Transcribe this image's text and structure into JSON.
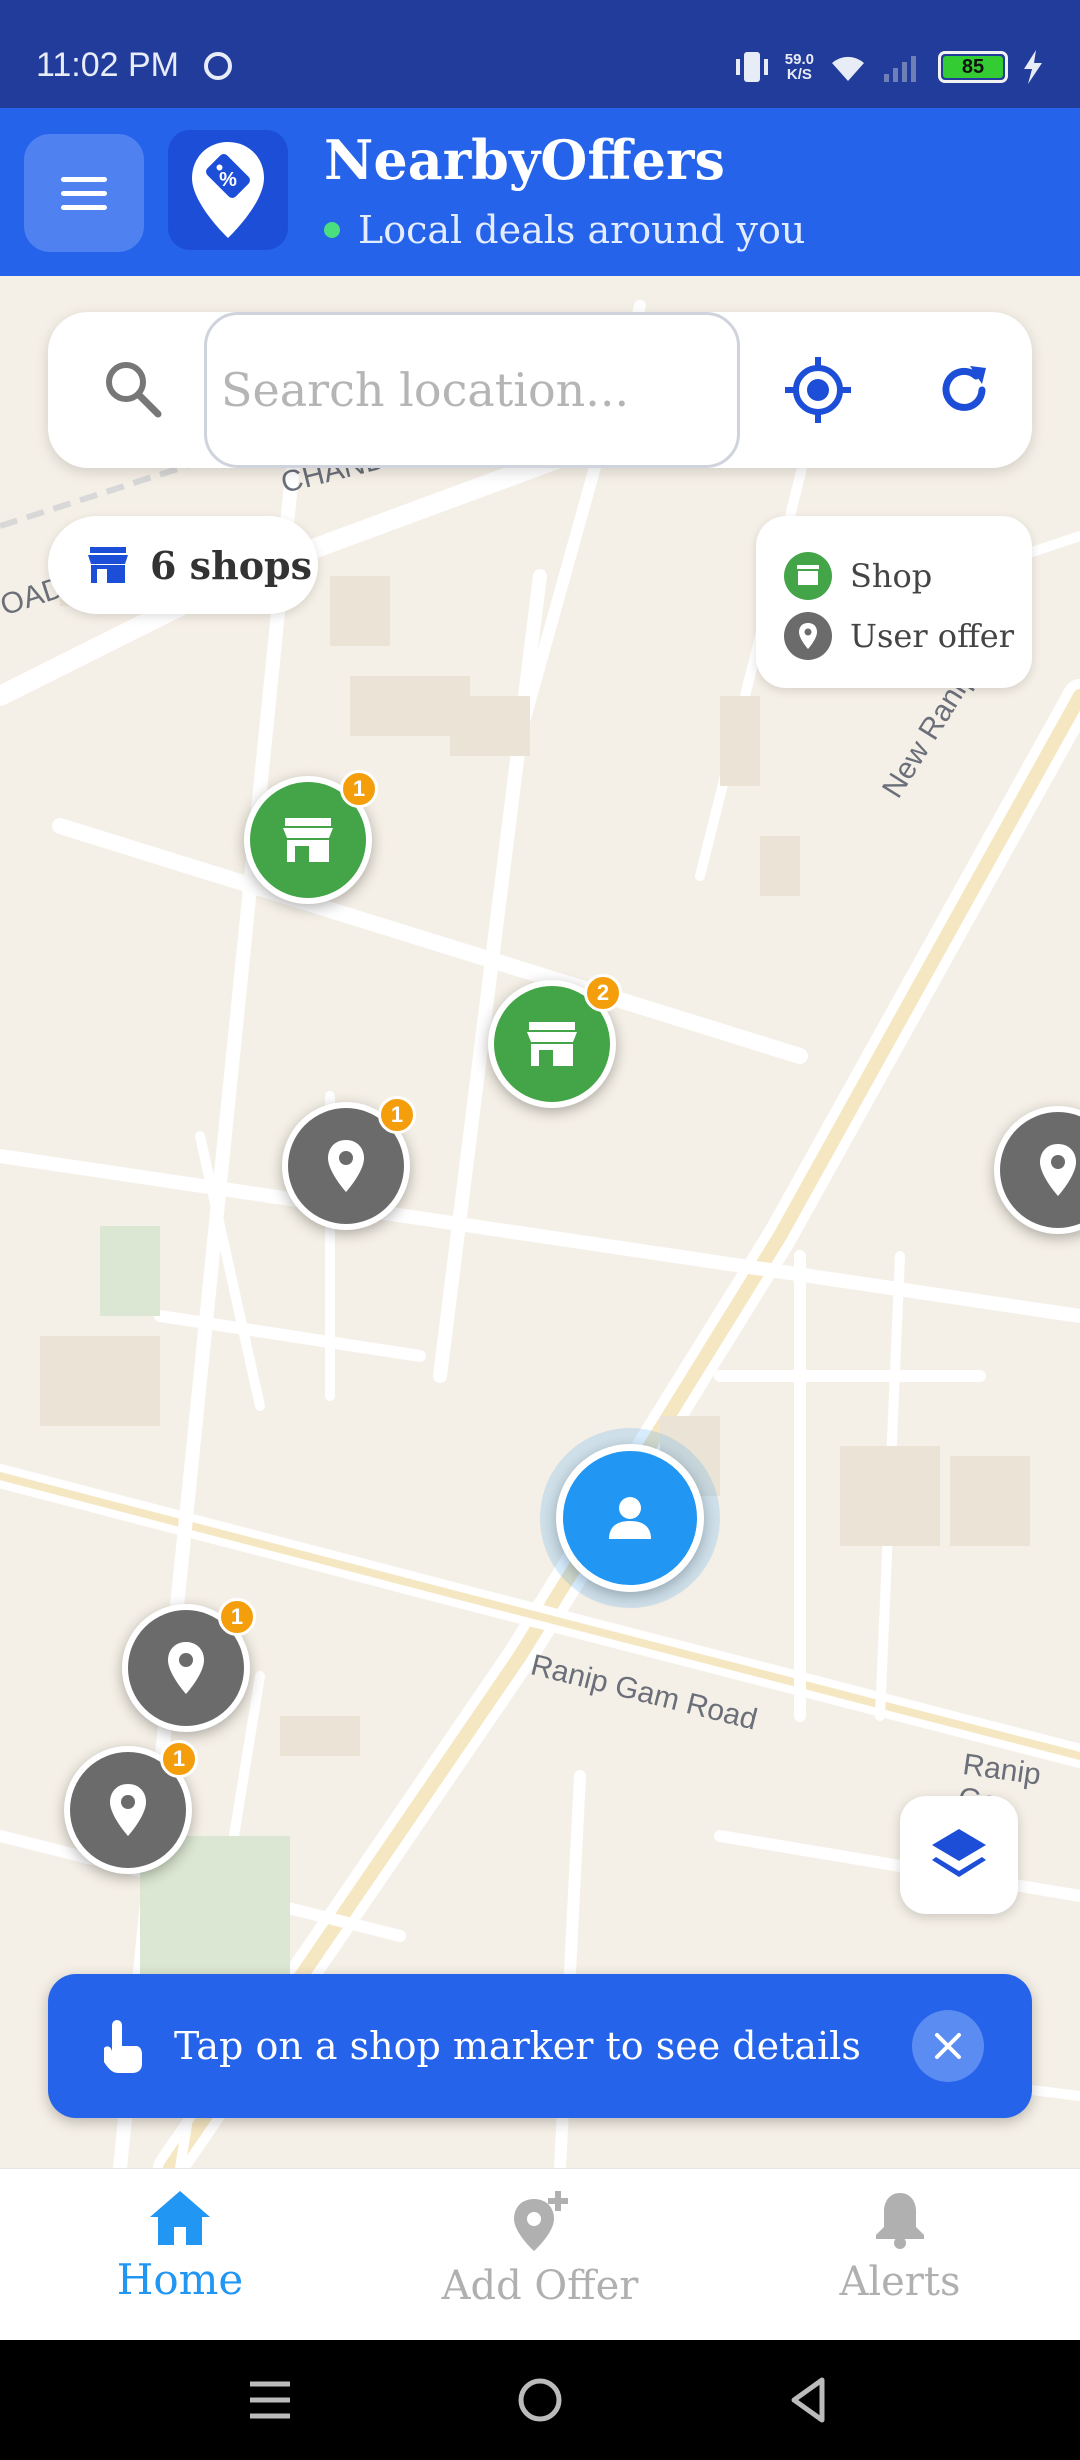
{
  "status_bar": {
    "time": "11:02 PM",
    "net_speed_value": "59.0",
    "net_speed_unit": "K/S",
    "battery": "85"
  },
  "header": {
    "title": "NearbyOffers",
    "subtitle": "Local deals around you",
    "colors": {
      "bar": "#2563eb",
      "online_dot": "#4ade80"
    }
  },
  "search": {
    "placeholder": "Search location...",
    "value": ""
  },
  "map": {
    "shops_count_label": "6 shops",
    "road_labels": [
      "CHANDE",
      "OAD",
      "New Ranip",
      "Ranip Gam Road",
      "Ranip Ga"
    ],
    "legend": {
      "shop_label": "Shop",
      "offer_label": "User offer"
    },
    "markers": [
      {
        "kind": "shop",
        "count": "1"
      },
      {
        "kind": "shop",
        "count": "2"
      },
      {
        "kind": "offer",
        "count": "1"
      },
      {
        "kind": "offer",
        "count": ""
      },
      {
        "kind": "offer",
        "count": "1"
      },
      {
        "kind": "offer",
        "count": "1"
      }
    ],
    "colors": {
      "shop": "#43a547",
      "offer": "#6b6b6b",
      "badge": "#f59e0b",
      "user": "#2196f3"
    }
  },
  "tip": {
    "text": "Tap on a shop marker to see details"
  },
  "bottom_nav": {
    "home": "Home",
    "add_offer": "Add Offer",
    "alerts": "Alerts",
    "active": "Home"
  }
}
